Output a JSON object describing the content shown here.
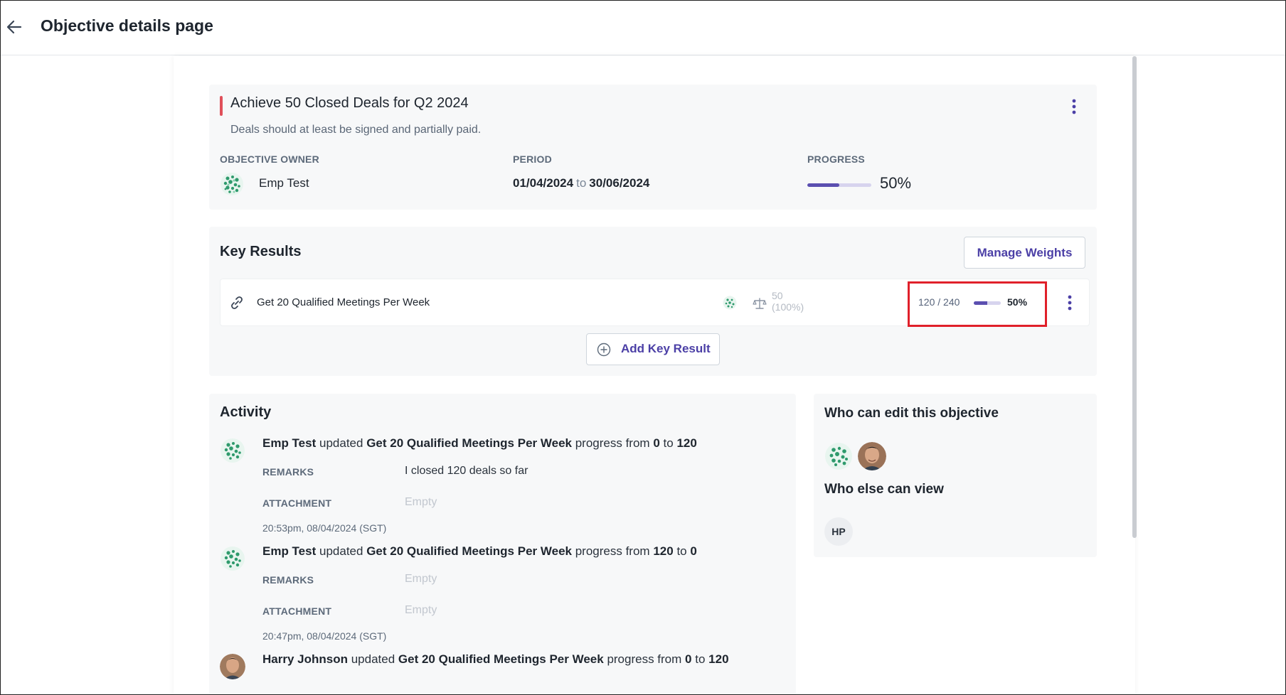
{
  "header": {
    "title": "Objective details page"
  },
  "objective": {
    "title": "Achieve 50 Closed Deals for Q2 2024",
    "description": "Deals should at least be signed and partially paid.",
    "owner_label": "OBJECTIVE OWNER",
    "owner_name": "Emp Test",
    "period_label": "PERIOD",
    "period_start": "01/04/2024",
    "period_to": "to",
    "period_end": "30/06/2024",
    "progress_label": "PROGRESS",
    "progress_value": 50,
    "progress_text": "50%"
  },
  "key_results": {
    "title": "Key Results",
    "manage_weights_label": "Manage Weights",
    "add_label": "Add Key Result",
    "items": [
      {
        "name": "Get 20 Qualified Meetings Per Week",
        "weight": "50",
        "weight_pct": "(100%)",
        "count": "120 / 240",
        "progress_value": 50,
        "progress_text": "50%"
      }
    ]
  },
  "activity": {
    "title": "Activity",
    "remarks_label": "REMARKS",
    "attachment_label": "ATTACHMENT",
    "empty_text": "Empty",
    "items": [
      {
        "user": "Emp Test",
        "verb": "updated",
        "target": "Get 20 Qualified Meetings Per Week",
        "progress_from_text": "progress from",
        "from": "0",
        "to_text": "to",
        "to": "120",
        "remarks": "I closed 120 deals so far",
        "attachment": "Empty",
        "time": "20:53pm, 08/04/2024 (SGT)"
      },
      {
        "user": "Emp Test",
        "verb": "updated",
        "target": "Get 20 Qualified Meetings Per Week",
        "progress_from_text": "progress from",
        "from": "120",
        "to_text": "to",
        "to": "0",
        "remarks": "Empty",
        "attachment": "Empty",
        "time": "20:47pm, 08/04/2024 (SGT)"
      },
      {
        "user": "Harry Johnson",
        "verb": "updated",
        "target": "Get 20 Qualified Meetings Per Week",
        "progress_from_text": "progress from",
        "from": "0",
        "to_text": "to",
        "to": "120"
      }
    ]
  },
  "permissions": {
    "edit_title": "Who can edit this objective",
    "view_title": "Who else can view",
    "viewer_initials": "HP"
  },
  "colors": {
    "accent": "#4b3fa6",
    "progress": "#5b4fb0",
    "objective_marker": "#e0505a",
    "highlight_box": "#e0202a"
  },
  "icons": [
    "back-arrow-icon",
    "kebab-menu-icon",
    "link-icon",
    "scale-icon",
    "plus-circle-icon"
  ]
}
